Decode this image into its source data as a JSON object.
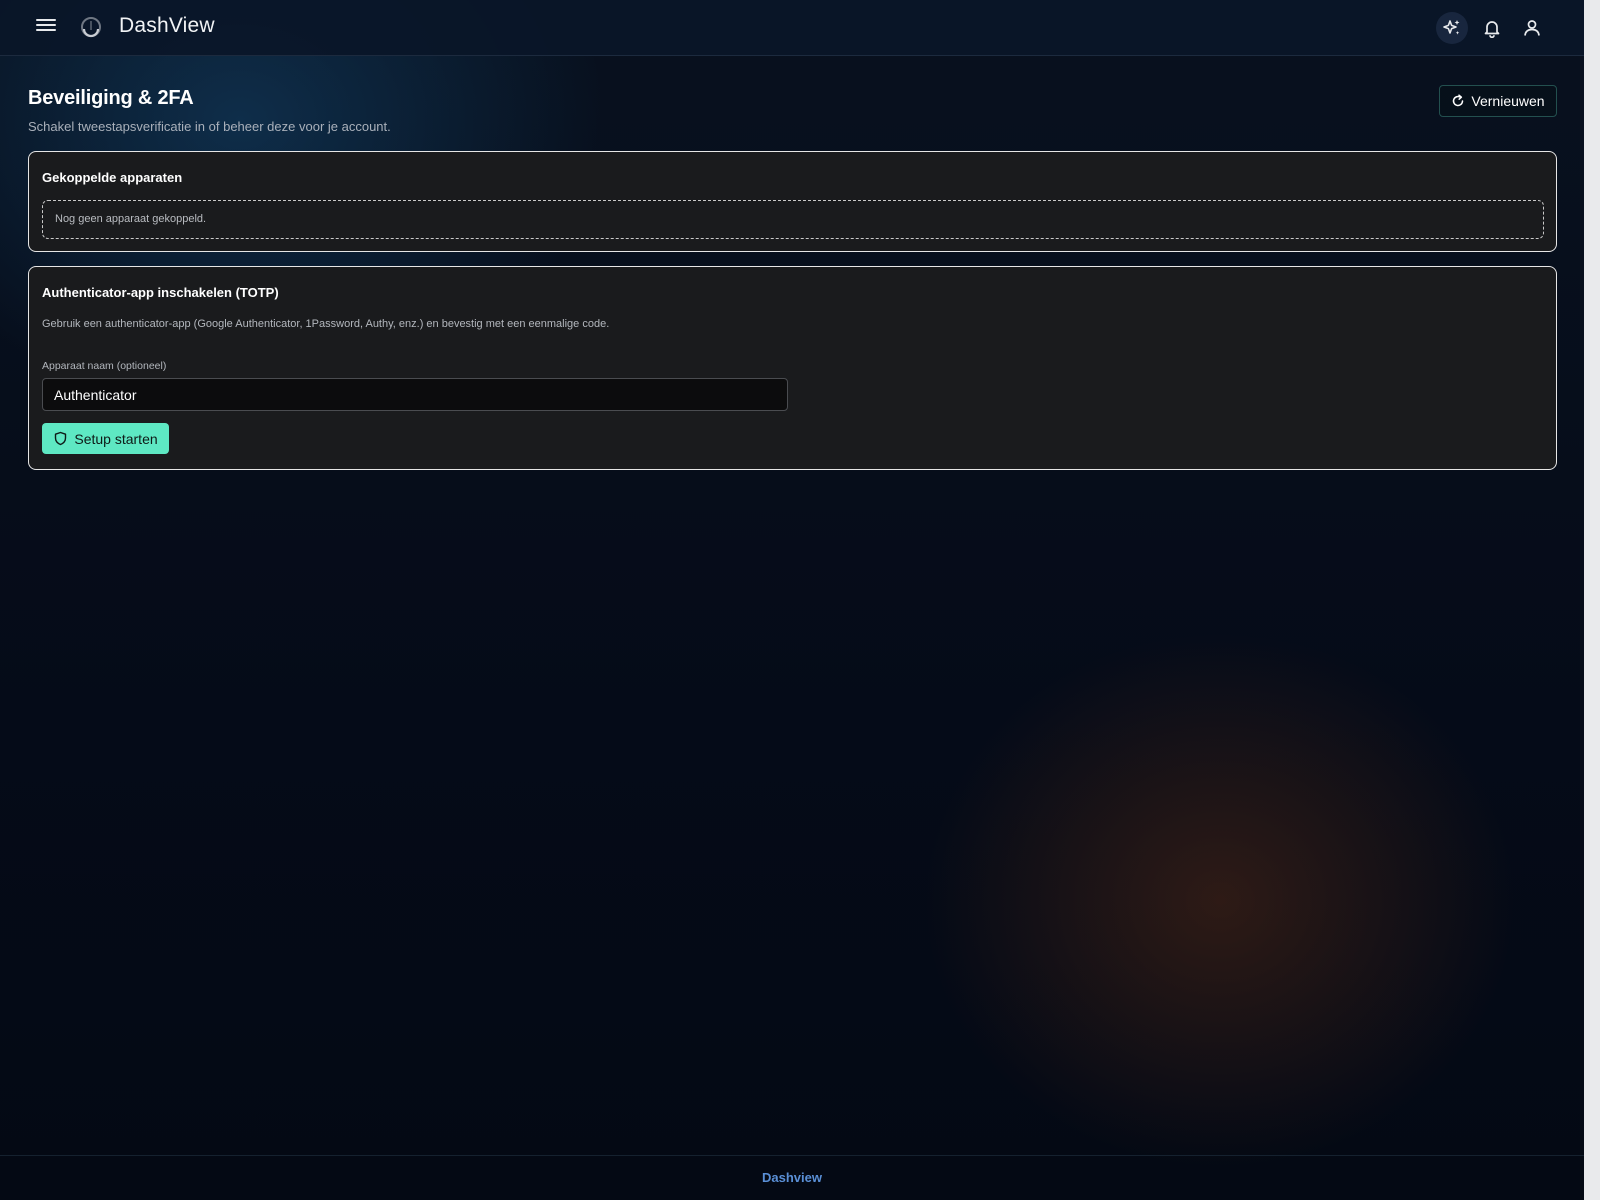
{
  "header": {
    "brand": "DashView"
  },
  "page": {
    "title": "Beveiliging & 2FA",
    "subtitle": "Schakel tweestapsverificatie in of beheer deze voor je account.",
    "refresh_label": "Vernieuwen"
  },
  "devices_card": {
    "title": "Gekoppelde apparaten",
    "empty_text": "Nog geen apparaat gekoppeld."
  },
  "totp_card": {
    "title": "Authenticator-app inschakelen (TOTP)",
    "description": "Gebruik een authenticator-app (Google Authenticator, 1Password, Authy, enz.) en bevestig met een eenmalige code.",
    "device_name_label": "Apparaat naam (optioneel)",
    "device_name_value": "Authenticator",
    "setup_button_label": "Setup starten"
  },
  "footer": {
    "link": "Dashview"
  },
  "icons": {
    "menu": "menu-icon",
    "logo": "logo-icon",
    "sparkle": "sparkle-icon",
    "bell": "bell-icon",
    "user": "user-icon",
    "refresh": "refresh-icon",
    "shield": "shield-icon"
  },
  "colors": {
    "accent": "#5ee8c3",
    "footer_link": "#5a8fd6",
    "card_bg": "#1a1b1d"
  }
}
